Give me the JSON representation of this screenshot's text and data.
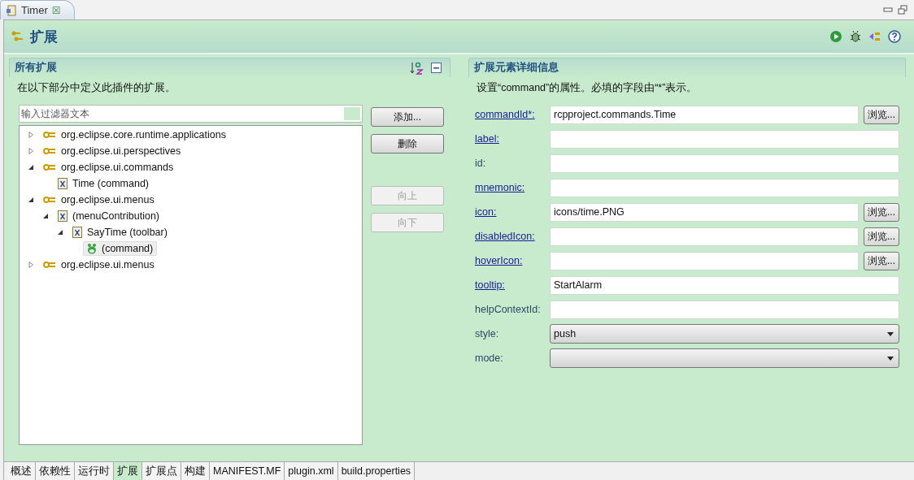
{
  "editor_tab": {
    "title": "Timer",
    "close": "☒"
  },
  "header": {
    "title": "扩展"
  },
  "left_section": {
    "title": "所有扩展",
    "description": "在以下部分中定义此插件的扩展。",
    "filter": {
      "placeholder": "输入过滤器文本"
    },
    "tree": [
      {
        "label": "org.eclipse.core.runtime.applications",
        "kind": "extension",
        "expanded": false,
        "selected": false
      },
      {
        "label": "org.eclipse.ui.perspectives",
        "kind": "extension",
        "expanded": false,
        "selected": false
      },
      {
        "label": "org.eclipse.ui.commands",
        "kind": "extension",
        "expanded": true,
        "selected": false,
        "children": [
          {
            "label": "Time (command)",
            "kind": "element",
            "selected": false
          }
        ]
      },
      {
        "label": "org.eclipse.ui.menus",
        "kind": "extension",
        "expanded": true,
        "selected": false,
        "children": [
          {
            "label": " (menuContribution)",
            "kind": "element",
            "expanded": true,
            "selected": false,
            "children": [
              {
                "label": "SayTime (toolbar)",
                "kind": "element",
                "expanded": true,
                "selected": false,
                "children": [
                  {
                    "label": "(command)",
                    "kind": "command",
                    "selected": true
                  }
                ]
              }
            ]
          }
        ]
      },
      {
        "label": "org.eclipse.ui.menus",
        "kind": "extension",
        "expanded": false,
        "selected": false
      }
    ],
    "buttons": [
      {
        "label": "添加...",
        "disabled": false
      },
      {
        "label": "删除",
        "disabled": false
      },
      {
        "label": "向上",
        "disabled": true
      },
      {
        "label": "向下",
        "disabled": true
      }
    ]
  },
  "right_section": {
    "title": "扩展元素详细信息",
    "description": "设置“command”的属性。必填的字段由“*”表示。",
    "fields": [
      {
        "label": "commandId*:",
        "link": true,
        "kind": "text",
        "value": "rcpproject.commands.Time",
        "browse": "浏览..."
      },
      {
        "label": "label:",
        "link": true,
        "kind": "text"
      },
      {
        "label": "id:",
        "link": false,
        "kind": "text"
      },
      {
        "label": "mnemonic:",
        "link": true,
        "kind": "text"
      },
      {
        "label": "icon:",
        "link": true,
        "kind": "text",
        "value": "icons/time.PNG",
        "browse": "浏览..."
      },
      {
        "label": "disabledIcon:",
        "link": true,
        "kind": "text",
        "browse": "浏览..."
      },
      {
        "label": "hoverIcon:",
        "link": true,
        "kind": "text",
        "browse": "浏览..."
      },
      {
        "label": "tooltip:",
        "link": true,
        "kind": "text",
        "value": "StartAlarm"
      },
      {
        "label": "helpContextId:",
        "link": false,
        "kind": "text"
      },
      {
        "label": "style:",
        "link": false,
        "kind": "select",
        "value": "push"
      },
      {
        "label": "mode:",
        "link": false,
        "kind": "select"
      }
    ]
  },
  "bottom_tabs": [
    {
      "label": "概述",
      "selected": false
    },
    {
      "label": "依赖性",
      "selected": false
    },
    {
      "label": "运行时",
      "selected": false
    },
    {
      "label": "扩展",
      "selected": true
    },
    {
      "label": "扩展点",
      "selected": false
    },
    {
      "label": "构建",
      "selected": false
    },
    {
      "label": "MANIFEST.MF",
      "selected": false
    },
    {
      "label": "plugin.xml",
      "selected": false
    },
    {
      "label": "build.properties",
      "selected": false
    }
  ]
}
